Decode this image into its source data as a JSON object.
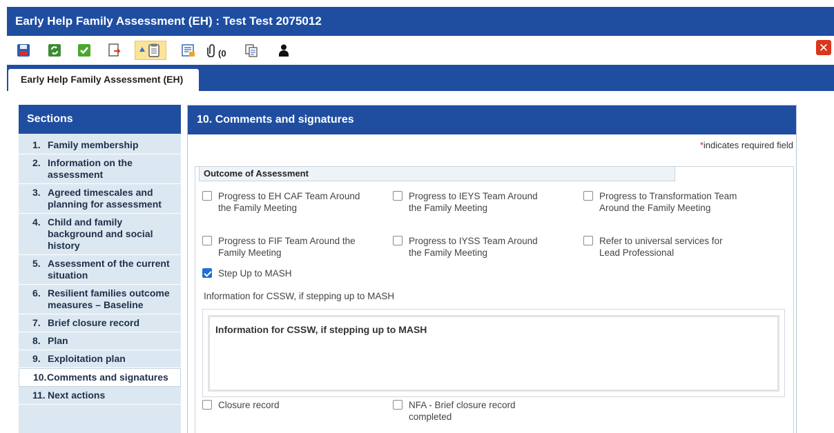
{
  "window": {
    "title": "Early Help Family Assessment (EH) : Test Test  2075012"
  },
  "toolbar": {
    "attachments_count": "(0"
  },
  "tab": {
    "label": "Early Help Family Assessment (EH)"
  },
  "sections": {
    "title": "Sections",
    "items": [
      {
        "num": "1.",
        "label": "Family membership"
      },
      {
        "num": "2.",
        "label": "Information on the assessment"
      },
      {
        "num": "3.",
        "label": "Agreed timescales and planning for assessment"
      },
      {
        "num": "4.",
        "label": "Child and family background and social history"
      },
      {
        "num": "5.",
        "label": "Assessment of the current situation"
      },
      {
        "num": "6.",
        "label": "Resilient families outcome measures – Baseline"
      },
      {
        "num": "7.",
        "label": "Brief closure record"
      },
      {
        "num": "8.",
        "label": "Plan"
      },
      {
        "num": "9.",
        "label": "Exploitation plan"
      },
      {
        "num": "10.",
        "label": "Comments and signatures"
      },
      {
        "num": "11.",
        "label": "Next actions"
      }
    ]
  },
  "panel": {
    "title": "10. Comments and signatures",
    "required_star": "*",
    "required_note": "indicates required field",
    "outcome_legend": "Outcome of Assessment",
    "options": [
      {
        "label": "Progress to EH CAF Team Around the Family Meeting",
        "checked": false
      },
      {
        "label": "Progress to IEYS Team Around the Family Meeting",
        "checked": false
      },
      {
        "label": "Progress to Transformation Team Around the Family Meeting",
        "checked": false
      },
      {
        "label": "Progress to FIF Team Around the Family Meeting",
        "checked": false
      },
      {
        "label": "Progress to IYSS Team Around the Family Meeting",
        "checked": false
      },
      {
        "label": "Refer to universal services for Lead Professional",
        "checked": false
      },
      {
        "label": "Step Up to MASH",
        "checked": true
      }
    ],
    "info_label": "Information for CSSW, if stepping up to MASH",
    "info_title": "Information for CSSW, if stepping up to MASH",
    "closure_options": [
      {
        "label": "Closure record",
        "checked": false
      },
      {
        "label": "NFA - Brief closure record completed",
        "checked": false
      }
    ]
  },
  "colors": {
    "header_blue": "#1f4ea1",
    "section_bg": "#dce8f1",
    "active_tool": "#fbe39a",
    "close_red": "#d9361c",
    "check_blue": "#1f6fd1"
  },
  "icons": [
    "save-icon",
    "refresh-icon",
    "complete-icon",
    "export-icon",
    "clipboard-warning-icon",
    "form-icon",
    "paperclip-icon",
    "copy-icon",
    "person-icon",
    "close-icon"
  ]
}
